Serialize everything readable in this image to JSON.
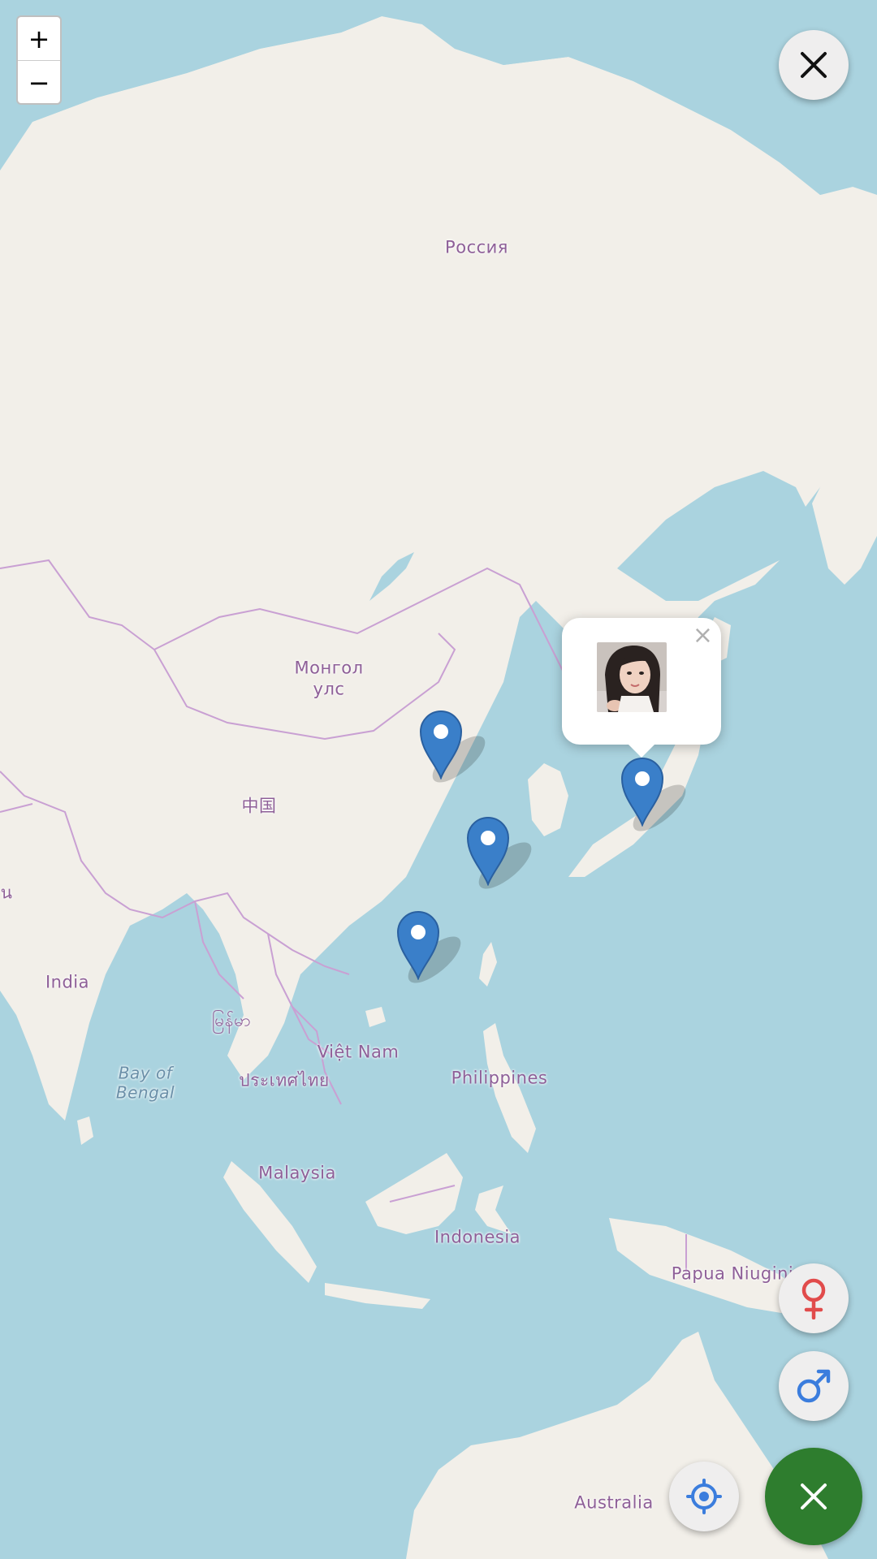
{
  "map": {
    "labels": {
      "russia": "Россия",
      "mongolia_1": "Монгол",
      "mongolia_2": "улс",
      "china": "中国",
      "india": "India",
      "myanmar": "မြန်မာ",
      "vietnam": "Việt Nam",
      "thailand": "ประเทศไทย",
      "bay_of_bengal_1": "Bay of",
      "bay_of_bengal_2": "Bengal",
      "philippines": "Philippines",
      "malaysia": "Malaysia",
      "indonesia": "Indonesia",
      "png": "Papua Niugini",
      "australia": "Australia",
      "edge_glyph": "น"
    },
    "colors": {
      "water": "#aad3df",
      "land": "#f2efe9",
      "border": "#c9a0d3",
      "marker": "#3a7fc9",
      "fab_primary": "#2e7d2e",
      "female_icon": "#e14b4b",
      "male_icon": "#3b7ddd",
      "locate_icon": "#3b7ddd"
    }
  },
  "controls": {
    "zoom_in": "+",
    "zoom_out": "−",
    "close_icon": "close-icon",
    "female_filter_icon": "female-symbol-icon",
    "male_filter_icon": "male-symbol-icon",
    "locate_icon": "locate-me-icon",
    "fab_icon": "close-icon"
  },
  "popup": {
    "close_label": "×",
    "avatar_icon": "user-avatar-photo"
  },
  "markers": [
    {
      "name": "marker-beijing"
    },
    {
      "name": "marker-japan"
    },
    {
      "name": "marker-shanghai"
    },
    {
      "name": "marker-guangzhou"
    }
  ]
}
